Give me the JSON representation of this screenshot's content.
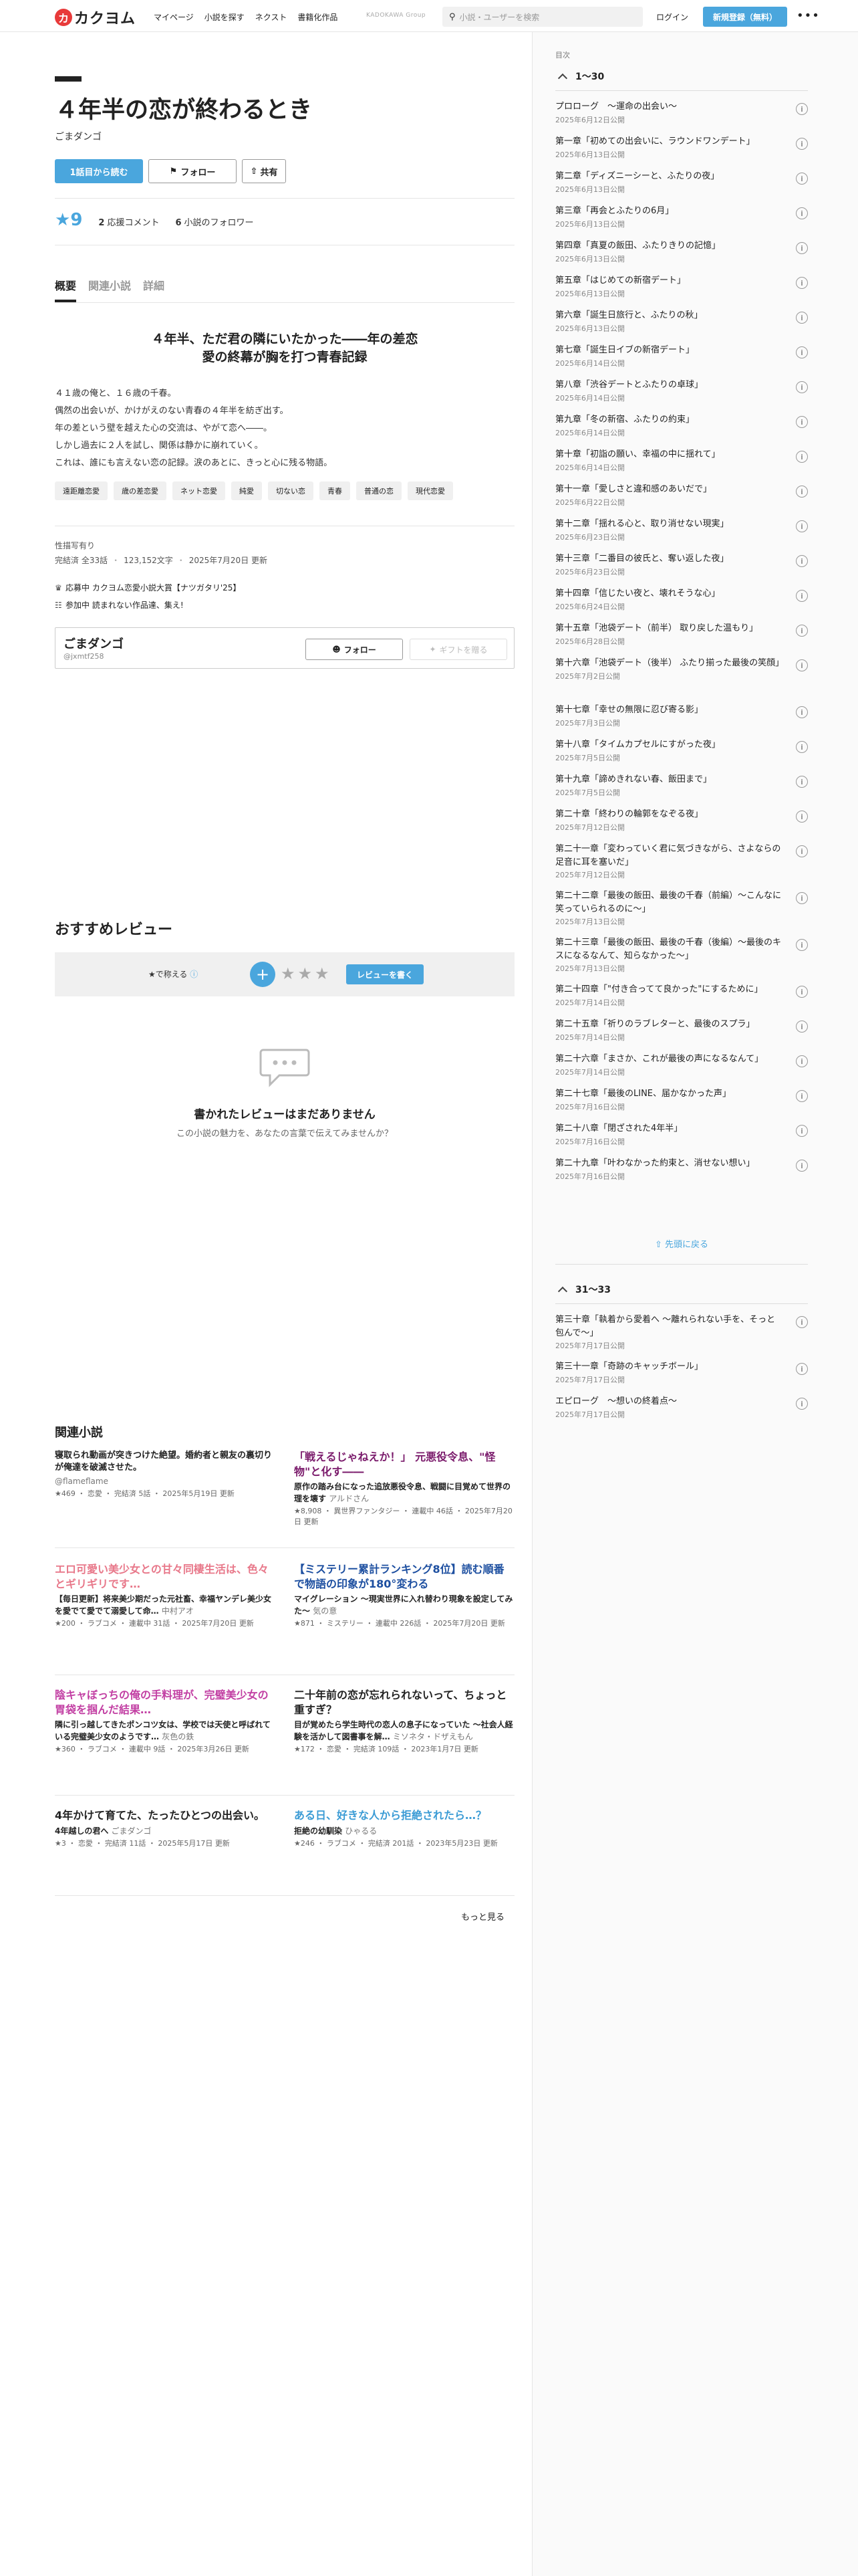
{
  "header": {
    "logo_mark": "カ",
    "logo_text": "カクヨム",
    "nav": [
      "マイページ",
      "小説を探す",
      "ネクスト",
      "書籍化作品"
    ],
    "group_label": "KADOKAWA Group",
    "search_placeholder": "小説・ユーザーを検索",
    "login": "ログイン",
    "signup": "新規登録（無料）"
  },
  "work": {
    "title": "４年半の恋が終わるとき",
    "author": "ごまダンゴ",
    "btn_read": "1話目から読む",
    "btn_follow": "フォロー",
    "btn_share": "共有",
    "stars": "9",
    "comments_count": "2",
    "comments_label": "応援コメント",
    "followers_count": "6",
    "followers_label": "小説のフォロワー"
  },
  "tabs": [
    "概要",
    "関連小説",
    "詳細"
  ],
  "catch_lines": [
    "４年半、ただ君の隣にいたかった――年の差恋",
    "愛の終幕が胸を打つ青春記録"
  ],
  "intro_lines": [
    "４１歳の俺と、１６歳の千春。",
    "偶然の出会いが、かけがえのない青春の４年半を紡ぎ出す。",
    "年の差という壁を越えた心の交流は、やがて恋へ――。",
    "しかし過去に２人を試し、関係は静かに崩れていく。",
    "これは、誰にも言えない恋の記録。涙のあとに、きっと心に残る物語。"
  ],
  "tags": [
    "遠距離恋愛",
    "歳の差恋愛",
    "ネット恋愛",
    "純愛",
    "切ない恋",
    "青春",
    "普通の恋",
    "現代恋愛"
  ],
  "meta": {
    "rating": "性描写有り",
    "status": "完結済 全33話",
    "chars": "123,152文字",
    "updated": "2025年7月20日 更新"
  },
  "events": [
    {
      "icon": "trophy-icon",
      "text": "応募中 カクヨム恋愛小説大賞【ナツガタリ'25】"
    },
    {
      "icon": "calendar-icon",
      "text": "参加中 読まれない作品達、集え!"
    }
  ],
  "author_card": {
    "name": "ごまダンゴ",
    "id": "@jxmtf258",
    "follow": "フォロー",
    "gift": "ギフトを贈る"
  },
  "reviews": {
    "title": "おすすめレビュー",
    "rate_label": "★で称える",
    "write": "レビューを書く",
    "empty_title": "書かれたレビューはまだありません",
    "empty_sub": "この小説の魅力を、あなたの言葉で伝えてみませんか？"
  },
  "related": {
    "title": "関連小説",
    "more": "もっと見る",
    "items": [
      {
        "title": "寝取られ動画が突きつけた絶望。婚約者と親友の裏切りが俺達を破滅させた。",
        "color": "#222222",
        "catch": "",
        "author": "@flameflame",
        "meta": "★469 ・ 恋愛 ・ 完結済 5話 ・ 2025年5月19日 更新"
      },
      {
        "title": "「戦えるじゃねえか！」 元悪役令息、\"怪物\"と化す――",
        "color": "#7a1a6b",
        "catch": "原作の踏み台になった追放悪役令息、戦闘に目覚めて世界の理を壊す",
        "author": "アルドさん",
        "meta": "★8,908 ・ 異世界ファンタジー ・ 連載中 46話 ・ 2025年7月20日 更新"
      },
      {
        "title": "エロ可愛い美少女との甘々同棲生活は、色々とギリギリです…",
        "color": "#e8788a",
        "catch": "【毎日更新】将来美少期だった元社畜、幸福ヤンデレ美少女を愛でて愛でて溺愛して命…",
        "author": "中村アオ",
        "meta": "★200 ・ ラブコメ ・ 連載中 31話 ・ 2025年7月20日 更新"
      },
      {
        "title": "【ミステリー累計ランキング8位】読む順番で物語の印象が180°変わる",
        "color": "#1d4fa0",
        "catch": "マイグレーション ～現実世界に入れ替わり現象を設定してみた～",
        "author": "気の意",
        "meta": "★871 ・ ミステリー ・ 連載中 226話 ・ 2025年7月20日 更新"
      },
      {
        "title": "陰キャぼっちの俺の手料理が、完璧美少女の胃袋を掴んだ結果…",
        "color": "#c23fa3",
        "catch": "隣に引っ越してきたポンコツ女は、学校では天使と呼ばれている完璧美少女のようです…",
        "author": "灰色の鉄",
        "meta": "★360 ・ ラブコメ ・ 連載中 9話 ・ 2025年3月26日 更新"
      },
      {
        "title": "二十年前の恋が忘れられないって、ちょっと重すぎ？",
        "color": "#222222",
        "catch": "目が覚めたら学生時代の恋人の息子になっていた ～社会人経験を活かして図書事を解…",
        "author": "ミソネタ・ドザえもん",
        "meta": "★172 ・ 恋愛 ・ 完結済 109話 ・ 2023年1月7日 更新"
      },
      {
        "title": "4年かけて育てた、たったひとつの出会い。",
        "color": "#222222",
        "catch": "4年越しの君へ",
        "author": "ごまダンゴ",
        "meta": "★3 ・ 恋愛 ・ 完結済 11話 ・ 2025年5月17日 更新"
      },
      {
        "title": "ある日、好きな人から拒絶されたら…？",
        "color": "#3a9bd5",
        "catch": "拒絶の幼馴染",
        "author": "ひゃるる",
        "meta": "★246 ・ ラブコメ ・ 完結済 201話 ・ 2023年5月23日 更新"
      }
    ]
  },
  "toc": {
    "heading": "目次",
    "group1": "1〜30",
    "group2": "31〜33",
    "back_to_top": "先頭に戻る",
    "group1_items": [
      {
        "t": "プロローグ　～運命の出会い～",
        "d": "2025年6月12日公開"
      },
      {
        "t": "第一章「初めての出会いに、ラウンドワンデート」",
        "d": "2025年6月13日公開"
      },
      {
        "t": "第二章「ディズニーシーと、ふたりの夜」",
        "d": "2025年6月13日公開"
      },
      {
        "t": "第三章「再会とふたりの6月」",
        "d": "2025年6月13日公開"
      },
      {
        "t": "第四章「真夏の飯田、ふたりきりの記憶」",
        "d": "2025年6月13日公開"
      },
      {
        "t": "第五章「はじめての新宿デート」",
        "d": "2025年6月13日公開"
      },
      {
        "t": "第六章「誕生日旅行と、ふたりの秋」",
        "d": "2025年6月13日公開"
      },
      {
        "t": "第七章「誕生日イブの新宿デート」",
        "d": "2025年6月14日公開"
      },
      {
        "t": "第八章「渋谷デートとふたりの卓球」",
        "d": "2025年6月14日公開"
      },
      {
        "t": "第九章「冬の新宿、ふたりの約束」",
        "d": "2025年6月14日公開"
      },
      {
        "t": "第十章「初詣の願い、幸福の中に揺れて」",
        "d": "2025年6月14日公開"
      },
      {
        "t": "第十一章「愛しさと違和感のあいだで」",
        "d": "2025年6月22日公開"
      },
      {
        "t": "第十二章「揺れる心と、取り消せない現実」",
        "d": "2025年6月23日公開"
      },
      {
        "t": "第十三章「二番目の彼氏と、奪い返した夜」",
        "d": "2025年6月23日公開"
      },
      {
        "t": "第十四章「信じたい夜と、壊れそうな心」",
        "d": "2025年6月24日公開"
      },
      {
        "t": "第十五章「池袋デート（前半） 取り戻した温もり」",
        "d": "2025年6月28日公開"
      },
      {
        "t": "第十六章「池袋デート（後半） ふたり揃った最後の笑顔」",
        "d": "2025年7月2日公開"
      },
      {
        "t": "第十七章「幸せの無限に忍び寄る影」",
        "d": "2025年7月3日公開"
      },
      {
        "t": "第十八章「タイムカプセルにすがった夜」",
        "d": "2025年7月5日公開"
      },
      {
        "t": "第十九章「諦めきれない春、飯田まで」",
        "d": "2025年7月5日公開"
      },
      {
        "t": "第二十章「終わりの輪郭をなぞる夜」",
        "d": "2025年7月12日公開"
      },
      {
        "t": "第二十一章「変わっていく君に気づきながら、さよならの足音に耳を塞いだ」",
        "d": "2025年7月12日公開"
      },
      {
        "t": "第二十二章「最後の飯田、最後の千春（前編）～こんなに笑っていられるのに～」",
        "d": "2025年7月13日公開"
      },
      {
        "t": "第二十三章「最後の飯田、最後の千春（後編）～最後のキスになるなんて、知らなかった～」",
        "d": "2025年7月13日公開"
      },
      {
        "t": "第二十四章「\"付き合ってて良かった\"にするために」",
        "d": "2025年7月14日公開"
      },
      {
        "t": "第二十五章「祈りのラブレターと、最後のスプラ」",
        "d": "2025年7月14日公開"
      },
      {
        "t": "第二十六章「まさか、これが最後の声になるなんて」",
        "d": "2025年7月14日公開"
      },
      {
        "t": "第二十七章「最後のLINE、届かなかった声」",
        "d": "2025年7月16日公開"
      },
      {
        "t": "第二十八章「閉ざされた4年半」",
        "d": "2025年7月16日公開"
      },
      {
        "t": "第二十九章「叶わなかった約束と、消せない想い」",
        "d": "2025年7月16日公開"
      }
    ],
    "group2_items": [
      {
        "t": "第三十章「執着から愛着へ ～離れられない手を、そっと包んで～」",
        "d": "2025年7月17日公開"
      },
      {
        "t": "第三十一章「奇跡のキャッチボール」",
        "d": "2025年7月17日公開"
      },
      {
        "t": "エピローグ　～想いの終着点～",
        "d": "2025年7月17日公開"
      }
    ]
  }
}
